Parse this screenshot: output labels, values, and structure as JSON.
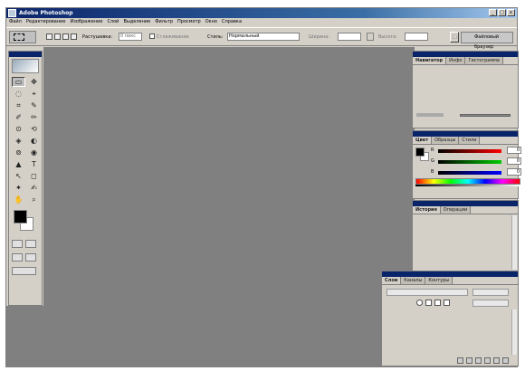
{
  "app": {
    "title": "Adobe Photoshop"
  },
  "window_controls": {
    "minimize": "_",
    "maximize": "□",
    "close": "x"
  },
  "menu": [
    "Файл",
    "Редактирование",
    "Изображение",
    "Слой",
    "Выделение",
    "Фильтр",
    "Просмотр",
    "Окно",
    "Справка"
  ],
  "options": {
    "feather_label": "Растушевка:",
    "feather_value": "0 пикс",
    "antialias_label": "Сглаживание",
    "style_label": "Стиль:",
    "style_value": "Нормальный",
    "width_label": "Ширина:",
    "height_label": "Высота:",
    "file_browser": "Файловый браузер"
  },
  "toolbox": {
    "tools": [
      "▭",
      "✥",
      "◌",
      "⌖",
      "⌗",
      "✎",
      "✐",
      "✏",
      "⊙",
      "⟲",
      "◈",
      "◐",
      "⊚",
      "◉",
      "▲",
      "T",
      "↖",
      "◻",
      "✦",
      "✍",
      "✋",
      "⌕"
    ],
    "fg_color": "#000000",
    "bg_color": "#ffffff"
  },
  "navigator_palette": {
    "tabs": [
      "Навигатор",
      "Инфо",
      "Гистограмма"
    ]
  },
  "color_palette": {
    "tabs": [
      "Цвет",
      "Образцы",
      "Стили"
    ],
    "channels": [
      {
        "label": "R",
        "value": "0",
        "color": "#cc0000"
      },
      {
        "label": "G",
        "value": "0",
        "color": "#00aa00"
      },
      {
        "label": "B",
        "value": "0",
        "color": "#0000cc"
      }
    ]
  },
  "history_palette": {
    "tabs": [
      "История",
      "Операции"
    ]
  },
  "layers_palette": {
    "tabs": [
      "Слои",
      "Каналы",
      "Контуры"
    ]
  }
}
